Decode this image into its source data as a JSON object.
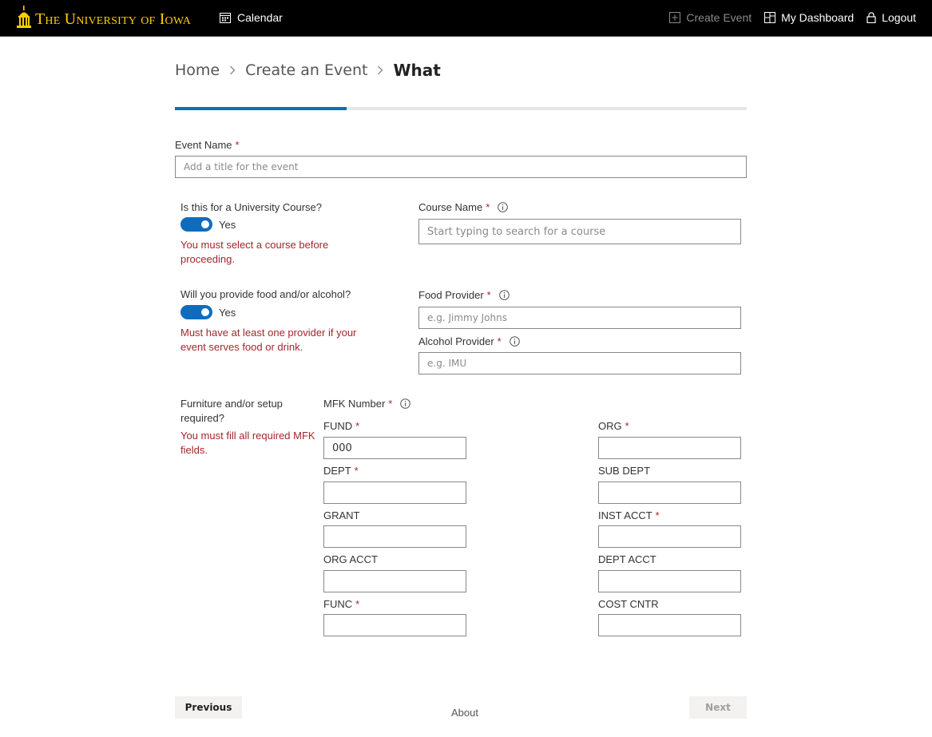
{
  "header": {
    "logo_text": "The University of Iowa",
    "calendar_label": "Calendar",
    "create_event_label": "Create Event",
    "dashboard_label": "My Dashboard",
    "logout_label": "Logout",
    "icons": [
      "capitol-dome-logo",
      "calendar-icon",
      "add-icon",
      "dashboard-icon",
      "lock-icon"
    ]
  },
  "breadcrumb": {
    "home": "Home",
    "create": "Create an Event",
    "current": "What"
  },
  "progress": {
    "fraction": 0.3
  },
  "form": {
    "event_name": {
      "label": "Event Name",
      "required": "*",
      "placeholder": "Add a title for the event",
      "value": ""
    },
    "course": {
      "question": "Is this for a University Course?",
      "toggle_label": "Yes",
      "toggle_on": true,
      "error": "You must select a course before proceeding.",
      "field_label": "Course Name",
      "required": "*",
      "placeholder": "Start typing to search for a course"
    },
    "food": {
      "question": "Will you provide food and/or alcohol?",
      "toggle_label": "Yes",
      "toggle_on": true,
      "error": "Must have at least one provider if your event serves food or drink.",
      "food_label": "Food Provider",
      "food_required": "*",
      "food_placeholder": "e.g. Jimmy Johns",
      "alcohol_label": "Alcohol Provider",
      "alcohol_required": "*",
      "alcohol_placeholder": "e.g. IMU"
    },
    "furniture": {
      "question": "Furniture and/or setup required?",
      "error": "You must fill all required MFK fields.",
      "mfk_label": "MFK Number",
      "mfk_required": "*"
    },
    "mfk_fields": {
      "fund": {
        "label": "FUND",
        "required": "*",
        "value": "000"
      },
      "org": {
        "label": "ORG",
        "required": "*",
        "value": ""
      },
      "dept": {
        "label": "DEPT",
        "required": "*",
        "value": ""
      },
      "sub_dept": {
        "label": "SUB DEPT",
        "required": "",
        "value": ""
      },
      "grant": {
        "label": "GRANT",
        "required": "",
        "value": ""
      },
      "inst_acct": {
        "label": "INST ACCT",
        "required": "*",
        "value": ""
      },
      "org_acct": {
        "label": "ORG ACCT",
        "required": "",
        "value": ""
      },
      "dept_acct": {
        "label": "DEPT ACCT",
        "required": "",
        "value": ""
      },
      "func": {
        "label": "FUNC",
        "required": "*",
        "value": ""
      },
      "cost_cntr": {
        "label": "COST CNTR",
        "required": "",
        "value": ""
      }
    }
  },
  "footer": {
    "previous_label": "Previous",
    "next_label": "Next",
    "about_label": "About"
  },
  "colors": {
    "topbar": "#000000",
    "brand_gold": "#ffcd00",
    "accent_blue": "#0f6cbd",
    "error_red": "#a4262c"
  }
}
